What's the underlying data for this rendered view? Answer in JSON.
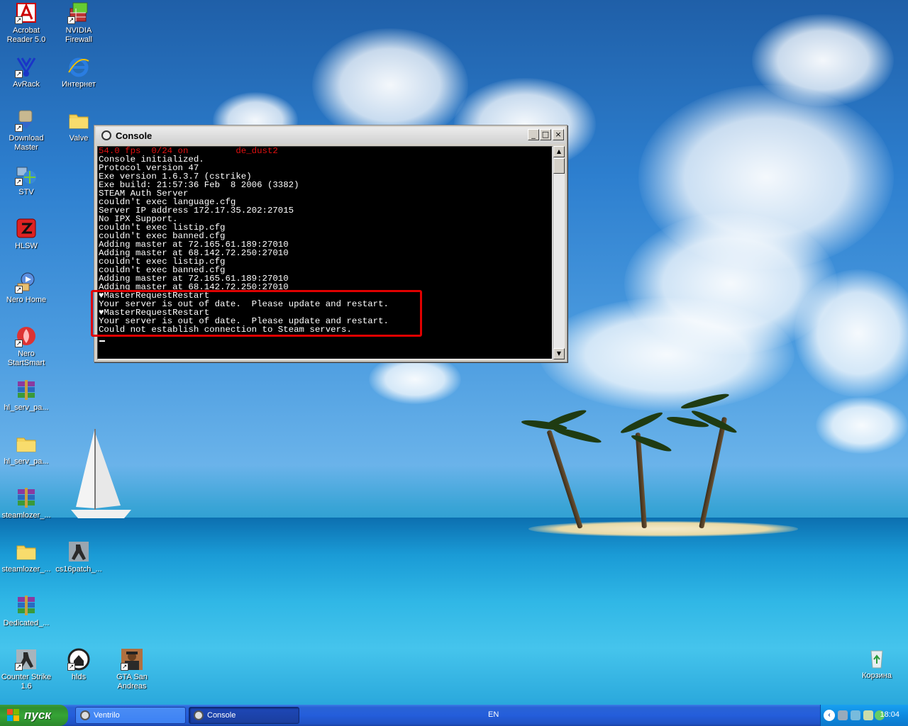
{
  "desktop_icons": [
    {
      "label": "Acrobat Reader 5.0",
      "icon": "acrobat-icon"
    },
    {
      "label": "NVIDIA Firewall",
      "icon": "nvidia-firewall-icon"
    },
    {
      "label": "AvRack",
      "icon": "avrack-icon"
    },
    {
      "label": "Интернет",
      "icon": "internet-explorer-icon"
    },
    {
      "label": "Download Master",
      "icon": "download-master-icon"
    },
    {
      "label": "Valve",
      "icon": "folder-icon"
    },
    {
      "label": "STV",
      "icon": "stv-icon"
    },
    {
      "label": "HLSW",
      "icon": "hlsw-icon"
    },
    {
      "label": "Nero Home",
      "icon": "nero-home-icon"
    },
    {
      "label": "Nero StartSmart",
      "icon": "nero-startsmart-icon"
    },
    {
      "label": "hl_serv_pa...",
      "icon": "winrar-archive-icon"
    },
    {
      "label": "hl_serv_pa...",
      "icon": "folder-icon"
    },
    {
      "label": "steamlozer_...",
      "icon": "winrar-archive-icon"
    },
    {
      "label": "steamlozer_...",
      "icon": "folder-icon"
    },
    {
      "label": "cs16patch_...",
      "icon": "cs-patch-icon"
    },
    {
      "label": "Dedicated_...",
      "icon": "winrar-archive-icon"
    },
    {
      "label": "Counter Strike 1.6",
      "icon": "counter-strike-icon"
    },
    {
      "label": "hlds",
      "icon": "hlds-icon"
    },
    {
      "label": "GTA San Andreas",
      "icon": "gta-icon"
    },
    {
      "label": "Корзина",
      "icon": "recycle-bin-icon"
    }
  ],
  "console": {
    "title": "Console",
    "buttons": {
      "minimize": "_",
      "maximize": "□",
      "close": "×"
    },
    "status_line": "54.0 fps  0/24 on         de_dust2",
    "lines": [
      "Console initialized.",
      "Protocol version 47",
      "Exe version 1.6.3.7 (cstrike)",
      "Exe build: 21:57:36 Feb  8 2006 (3382)",
      "STEAM Auth Server",
      "couldn't exec language.cfg",
      "Server IP address 172.17.35.202:27015",
      "No IPX Support.",
      "couldn't exec listip.cfg",
      "couldn't exec banned.cfg",
      "Adding master at 72.165.61.189:27010",
      "Adding master at 68.142.72.250:27010",
      "couldn't exec listip.cfg",
      "couldn't exec banned.cfg",
      "Adding master at 72.165.61.189:27010",
      "Adding master at 68.142.72.250:27010",
      "♥MasterRequestRestart",
      "Your server is out of date.  Please update and restart.",
      "♥MasterRequestRestart",
      "Your server is out of date.  Please update and restart.",
      "Could not establish connection to Steam servers."
    ]
  },
  "taskbar": {
    "start_label": "пуск",
    "tasks": [
      {
        "label": "Ventrilo",
        "active": false
      },
      {
        "label": "Console",
        "active": true
      }
    ],
    "language": "EN",
    "clock": "18:04"
  },
  "colors": {
    "highlight_box": "#e00000",
    "console_red_text": "#e01010",
    "taskbar_blue": "#245edb",
    "start_green": "#36a436"
  }
}
